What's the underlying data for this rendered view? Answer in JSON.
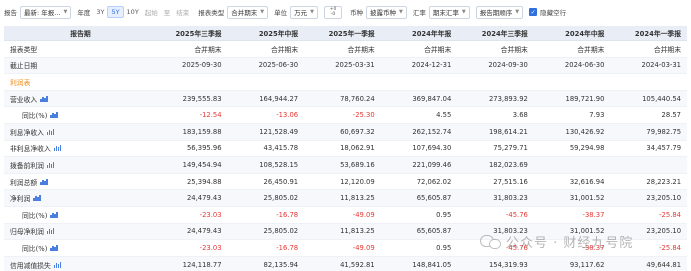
{
  "toolbar": {
    "report_label": "报告",
    "report_value": "最新: 年报...",
    "annual_label": "年度",
    "periods": [
      "3Y",
      "5Y",
      "10Y",
      "起始",
      "至",
      "结束"
    ],
    "period_active": "5Y",
    "report_type_label": "报表类型",
    "report_type_value": "合并期末",
    "unit_label": "单位",
    "unit_value": "万元",
    "unit_toggle_top": "+0",
    "unit_toggle_bottom": "-0",
    "currency_label": "币种",
    "currency_value": "披露币种",
    "fx_label": "汇率",
    "fx_value": "期末汇率",
    "order_label": "报告期顺序",
    "hide_empty_label": "隐藏空行"
  },
  "table": {
    "header_label": "报告期",
    "columns": [
      "2025年三季报",
      "2025年中报",
      "2025年一季报",
      "2024年年报",
      "2024年三季报",
      "2024年中报",
      "2024年一季报"
    ],
    "rows": [
      {
        "label": "报表类型",
        "values": [
          "合并期末",
          "合并期末",
          "合并期末",
          "合并期末",
          "合并期末",
          "合并期末",
          "合并期末"
        ]
      },
      {
        "label": "截止日期",
        "values": [
          "2025-09-30",
          "2025-06-30",
          "2025-03-31",
          "2024-12-31",
          "2024-09-30",
          "2024-06-30",
          "2024-03-31"
        ]
      },
      {
        "label": "利润表",
        "section": true,
        "values": [
          "",
          "",
          "",
          "",
          "",
          "",
          ""
        ]
      },
      {
        "label": "营业收入",
        "icon": true,
        "values": [
          "239,555.83",
          "164,944.27",
          "78,760.24",
          "369,847.04",
          "273,893.92",
          "189,721.90",
          "105,440.54"
        ]
      },
      {
        "label": "同比(%)",
        "indent": true,
        "icon": true,
        "values": [
          "-12.54",
          "-13.06",
          "-25.30",
          "4.55",
          "3.68",
          "7.93",
          "28.57"
        ]
      },
      {
        "label": "利息净收入",
        "icon": true,
        "values": [
          "183,159.88",
          "121,528.49",
          "60,697.32",
          "262,152.74",
          "198,614.21",
          "130,426.92",
          "79,982.75"
        ]
      },
      {
        "label": "非利息净收入",
        "icon": true,
        "values": [
          "56,395.96",
          "43,415.78",
          "18,062.91",
          "107,694.30",
          "75,279.71",
          "59,294.98",
          "34,457.79"
        ]
      },
      {
        "label": "拨备前利润",
        "icon": true,
        "values": [
          "149,454.94",
          "108,528.15",
          "53,689.16",
          "221,099.46",
          "182,023.69",
          "",
          ""
        ]
      },
      {
        "label": "利润总额",
        "icon": true,
        "values": [
          "25,394.88",
          "26,450.91",
          "12,120.09",
          "72,062.02",
          "27,515.16",
          "32,616.94",
          "28,223.21"
        ]
      },
      {
        "label": "净利润",
        "icon": true,
        "values": [
          "24,479.43",
          "25,805.02",
          "11,813.25",
          "65,605.87",
          "31,803.23",
          "31,001.52",
          "23,205.10"
        ]
      },
      {
        "label": "同比(%)",
        "indent": true,
        "icon": true,
        "values": [
          "-23.03",
          "-16.78",
          "-49.09",
          "0.95",
          "-45.76",
          "-38.37",
          "-25.84"
        ]
      },
      {
        "label": "归母净利润",
        "icon": true,
        "values": [
          "24,479.43",
          "25,805.02",
          "11,813.25",
          "65,605.87",
          "31,803.23",
          "31,001.52",
          "23,205.10"
        ]
      },
      {
        "label": "同比(%)",
        "indent": true,
        "icon": true,
        "values": [
          "-23.03",
          "-16.78",
          "-49.09",
          "0.95",
          "-45.76",
          "-38.37",
          "-25.84"
        ]
      },
      {
        "label": "信用减值损失",
        "icon": true,
        "values": [
          "124,118.77",
          "82,135.94",
          "41,592.81",
          "148,841.05",
          "154,319.93",
          "93,117.62",
          "49,644.81"
        ]
      }
    ]
  },
  "watermark": {
    "text": "公众号 · 财经九号院"
  }
}
